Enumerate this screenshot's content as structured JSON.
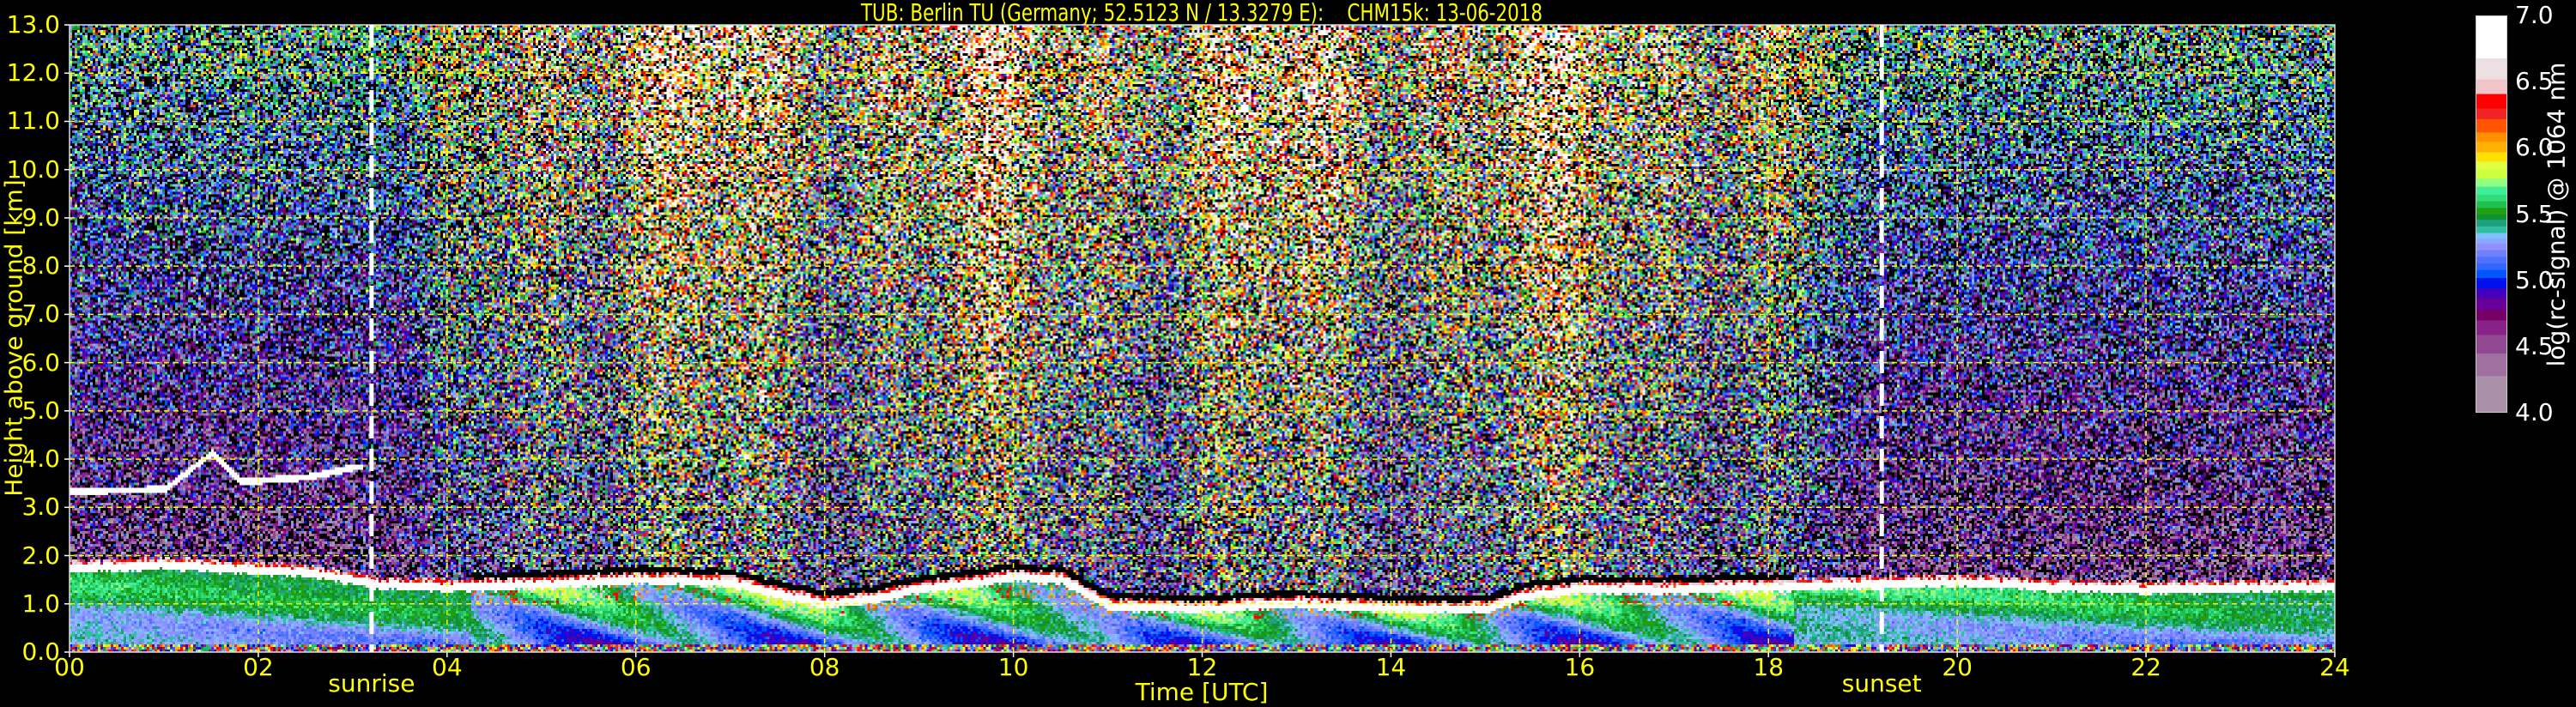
{
  "chart_data": {
    "type": "heatmap",
    "title": "TUB: Berlin TU (Germany; 52.5123 N / 13.3279 E):    CHM15k: 13-06-2018",
    "xlabel": "Time [UTC]",
    "ylabel": "Height above ground [km]",
    "xlim": [
      0,
      24
    ],
    "ylim": [
      0,
      13
    ],
    "xticks": [
      "00",
      "02",
      "04",
      "06",
      "08",
      "10",
      "12",
      "14",
      "16",
      "18",
      "20",
      "22",
      "24"
    ],
    "yticks": [
      "0.0",
      "1.0",
      "2.0",
      "3.0",
      "4.0",
      "5.0",
      "6.0",
      "7.0",
      "8.0",
      "9.0",
      "10.0",
      "11.0",
      "12.0",
      "13.0"
    ],
    "grid": true,
    "grid_color": "#ffff00",
    "annotations": [
      {
        "label": "sunrise",
        "time": 3.2
      },
      {
        "label": "sunset",
        "time": 19.2
      }
    ],
    "boundary_layer_top_km": [
      [
        0,
        1.75
      ],
      [
        1,
        1.8
      ],
      [
        2,
        1.7
      ],
      [
        2.7,
        1.6
      ],
      [
        3.2,
        1.4
      ],
      [
        4,
        1.35
      ],
      [
        5,
        1.4
      ],
      [
        6,
        1.5
      ],
      [
        7,
        1.45
      ],
      [
        7.5,
        1.2
      ],
      [
        8,
        1.0
      ],
      [
        8.5,
        1.1
      ],
      [
        9,
        1.3
      ],
      [
        10,
        1.55
      ],
      [
        10.5,
        1.5
      ],
      [
        11,
        0.95
      ],
      [
        12,
        0.9
      ],
      [
        13,
        1.0
      ],
      [
        14,
        0.9
      ],
      [
        15,
        0.9
      ],
      [
        15.5,
        1.2
      ],
      [
        16,
        1.3
      ],
      [
        17,
        1.3
      ],
      [
        18,
        1.35
      ],
      [
        19,
        1.4
      ],
      [
        20,
        1.45
      ],
      [
        21,
        1.35
      ],
      [
        22,
        1.3
      ],
      [
        24,
        1.35
      ]
    ],
    "cloud_layer_km": [
      [
        0,
        3.3
      ],
      [
        1,
        3.35
      ],
      [
        1.5,
        4.1
      ],
      [
        1.8,
        3.5
      ],
      [
        2.5,
        3.6
      ],
      [
        3.0,
        3.8
      ]
    ],
    "colorbar": {
      "label": "log(rc-signal) @ 1064 nm",
      "range": [
        4.0,
        7.0
      ],
      "ticks": [
        "4.0",
        "4.5",
        "5.0",
        "5.5",
        "6.0",
        "6.5",
        "7.0"
      ],
      "bounds": [
        4.0,
        4.28,
        4.45,
        4.59,
        4.7,
        4.78,
        4.87,
        4.94,
        5.02,
        5.08,
        5.13,
        5.18,
        5.23,
        5.28,
        5.32,
        5.36,
        5.41,
        5.46,
        5.5,
        5.55,
        5.6,
        5.65,
        5.71,
        5.77,
        5.84,
        5.9,
        5.97,
        6.05,
        6.12,
        6.22,
        6.3,
        6.41,
        6.52,
        6.68,
        7.0
      ],
      "colors": [
        "#aa90a8",
        "#a070a0",
        "#904890",
        "#882288",
        "#770066",
        "#660099",
        "#4400bb",
        "#0011ee",
        "#0055ff",
        "#3366ff",
        "#5070ff",
        "#7080ff",
        "#9090ff",
        "#88aaff",
        "#80c0ff",
        "#30c0a0",
        "#20a080",
        "#109030",
        "#20a010",
        "#20c050",
        "#30dd77",
        "#40ee99",
        "#90ff80",
        "#ccff40",
        "#e0ff40",
        "#ffe000",
        "#ffb000",
        "#ff9000",
        "#ff5500",
        "#f02424",
        "#ff0000",
        "#f0c4c8",
        "#ede0e3",
        "#ffffff"
      ]
    }
  }
}
